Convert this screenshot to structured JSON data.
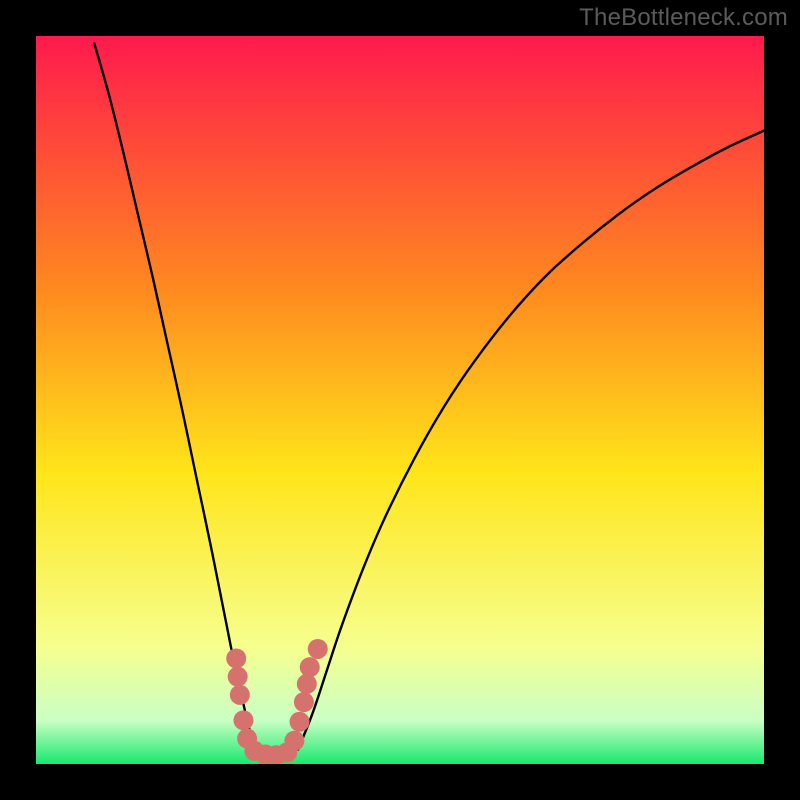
{
  "watermark": "TheBottleneck.com",
  "colors": {
    "frame": "#000000",
    "grad_top": "#ff1a4d",
    "grad_mid1": "#ff8a1f",
    "grad_mid2": "#ffe51a",
    "grad_mid3": "#f6ff8f",
    "grad_bottom_soft": "#caffc4",
    "grad_bottom": "#18e86f",
    "curve": "#000000",
    "marker": "#d6726d"
  },
  "chart_data": {
    "type": "line",
    "title": "",
    "xlabel": "",
    "ylabel": "",
    "xlim": [
      0,
      100
    ],
    "ylim": [
      0,
      100
    ],
    "curves": [
      {
        "name": "left",
        "x": [
          8,
          10,
          12,
          14,
          16,
          18,
          20,
          22,
          24,
          26,
          27,
          28,
          29,
          30
        ],
        "y": [
          99,
          92,
          84,
          75.5,
          67,
          58,
          49,
          39.5,
          30,
          20,
          15,
          10.5,
          6,
          2
        ]
      },
      {
        "name": "right",
        "x": [
          36,
          38,
          40,
          42,
          45,
          48,
          52,
          56,
          60,
          65,
          70,
          75,
          80,
          85,
          90,
          95,
          100
        ],
        "y": [
          2,
          7,
          13,
          19,
          27,
          34,
          42,
          49,
          55,
          61.5,
          67,
          71.5,
          75.5,
          79,
          82,
          84.7,
          87
        ]
      }
    ],
    "markers": {
      "name": "optimal-band",
      "points": [
        {
          "x": 27.5,
          "y": 14.5
        },
        {
          "x": 27.7,
          "y": 12.0
        },
        {
          "x": 28.0,
          "y": 9.5
        },
        {
          "x": 28.5,
          "y": 6.0
        },
        {
          "x": 29.0,
          "y": 3.5
        },
        {
          "x": 30.0,
          "y": 1.8
        },
        {
          "x": 31.5,
          "y": 1.3
        },
        {
          "x": 33.0,
          "y": 1.2
        },
        {
          "x": 34.5,
          "y": 1.6
        },
        {
          "x": 35.5,
          "y": 3.2
        },
        {
          "x": 36.2,
          "y": 5.8
        },
        {
          "x": 36.8,
          "y": 8.5
        },
        {
          "x": 37.2,
          "y": 11.0
        },
        {
          "x": 37.6,
          "y": 13.3
        },
        {
          "x": 38.7,
          "y": 15.8
        }
      ]
    }
  }
}
